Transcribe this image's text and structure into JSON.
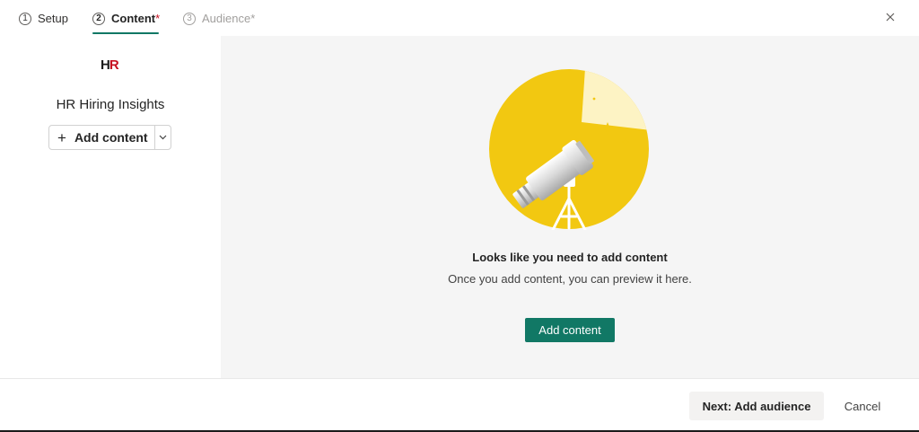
{
  "stepper": {
    "steps": [
      {
        "number": "1",
        "label": "Setup",
        "required": "",
        "state": "completed"
      },
      {
        "number": "2",
        "label": "Content",
        "required": "*",
        "state": "active"
      },
      {
        "number": "3",
        "label": "Audience",
        "required": "*",
        "state": "disabled"
      }
    ],
    "close_icon": "close-icon",
    "accent_color": "#117865"
  },
  "sidebar": {
    "logo": {
      "h": "H",
      "r": "R"
    },
    "title": "HR Hiring Insights",
    "add_button": {
      "plus": "+",
      "label": "Add content",
      "icon": "chevron-down-icon"
    }
  },
  "preview": {
    "illustration": "telescope-illustration",
    "heading": "Looks like you need to add content",
    "subtext": "Once you add content, you can preview it here.",
    "add_button_label": "Add content",
    "accent_yellow": "#f2c811"
  },
  "footer": {
    "next_label": "Next: Add audience",
    "cancel_label": "Cancel"
  }
}
